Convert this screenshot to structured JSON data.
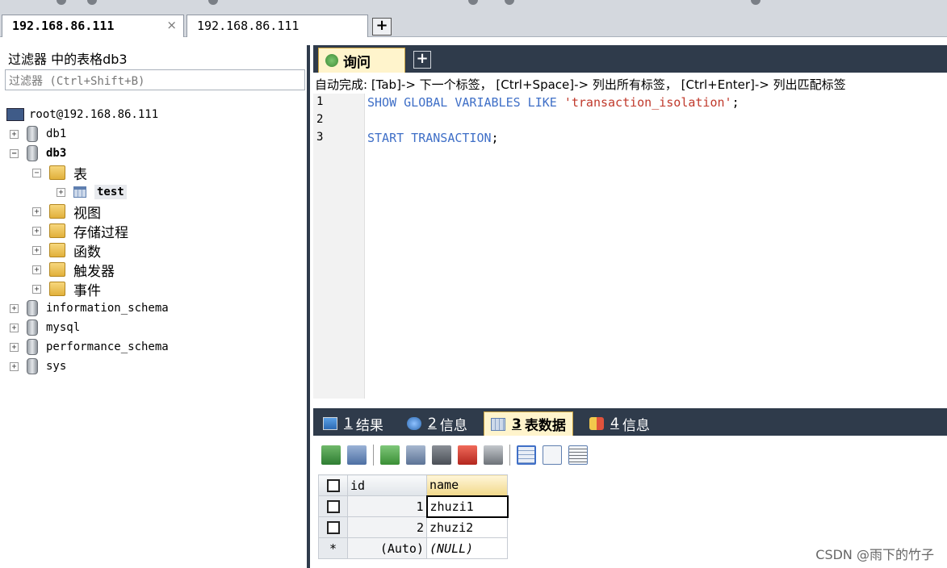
{
  "window": {
    "tabs": [
      {
        "label": "192.168.86.111",
        "active": true,
        "close": "×"
      },
      {
        "label": "192.168.86.111",
        "active": false
      }
    ],
    "new_tab_label": "+"
  },
  "sidebar": {
    "filter_title": "过滤器 中的表格db3",
    "filter_placeholder": "过滤器 (Ctrl+Shift+B)",
    "server": "root@192.168.86.111",
    "databases": [
      {
        "name": "db1",
        "expander": "+"
      },
      {
        "name": "db3",
        "expander": "−",
        "expanded": true,
        "folders": [
          {
            "name": "表",
            "expander": "−",
            "expanded": true,
            "tables": [
              {
                "name": "test",
                "expander": "+"
              }
            ]
          },
          {
            "name": "视图",
            "expander": "+"
          },
          {
            "name": "存储过程",
            "expander": "+"
          },
          {
            "name": "函数",
            "expander": "+"
          },
          {
            "name": "触发器",
            "expander": "+"
          },
          {
            "name": "事件",
            "expander": "+"
          }
        ]
      },
      {
        "name": "information_schema",
        "expander": "+"
      },
      {
        "name": "mysql",
        "expander": "+"
      },
      {
        "name": "performance_schema",
        "expander": "+"
      },
      {
        "name": "sys",
        "expander": "+"
      }
    ]
  },
  "query": {
    "tab_label": "询问",
    "new_tab_label": "+",
    "autocomplete_hint": "自动完成: [Tab]-> 下一个标签， [Ctrl+Space]-> 列出所有标签， [Ctrl+Enter]-> 列出匹配标签",
    "lines": [
      {
        "no": "1",
        "kw": "SHOW GLOBAL VARIABLES LIKE ",
        "str": "'transaction_isolation'",
        "end": ";"
      },
      {
        "no": "2",
        "kw": "",
        "str": "",
        "end": ""
      },
      {
        "no": "3",
        "kw": "START TRANSACTION",
        "str": "",
        "end": ";"
      }
    ]
  },
  "results": {
    "tabs": [
      {
        "num": "1",
        "label": "结果",
        "icon": "result-icon"
      },
      {
        "num": "2",
        "label": "信息",
        "icon": "info-icon"
      },
      {
        "num": "3",
        "label": "表数据",
        "icon": "table-data-icon",
        "active": true
      },
      {
        "num": "4",
        "label": "信息",
        "icon": "info-icon"
      }
    ],
    "toolbar_icons": [
      "export-icon",
      "import-icon",
      "add-row-icon",
      "duplicate-row-icon",
      "save-icon",
      "delete-icon",
      "cancel-icon",
      "grid-view-icon",
      "form-view-icon",
      "text-view-icon"
    ],
    "columns": [
      "id",
      "name"
    ],
    "rows": [
      {
        "marker": "",
        "id": "1",
        "name": "zhuzi1"
      },
      {
        "marker": "",
        "id": "2",
        "name": "zhuzi2"
      },
      {
        "marker": "*",
        "id": "(Auto)",
        "name": "(NULL)"
      }
    ]
  },
  "watermark": "CSDN @雨下的竹子",
  "colors": {
    "dark_bar": "#2f3b4b",
    "active_tab": "#fff4cc",
    "keyword": "#3f6fc7",
    "string": "#c0392b"
  }
}
